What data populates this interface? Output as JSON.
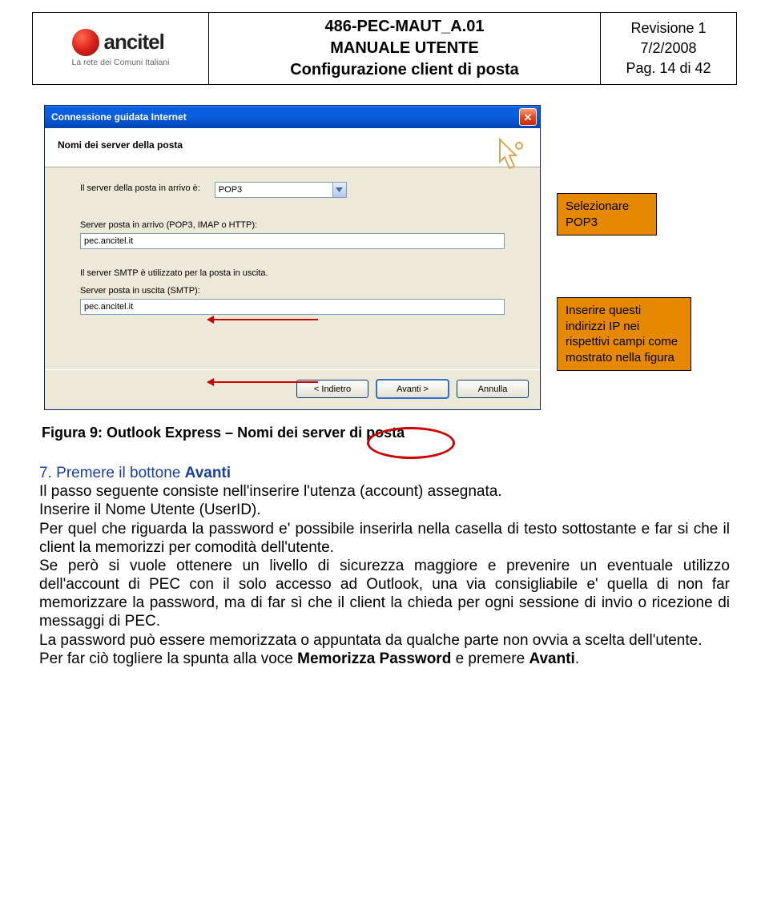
{
  "header": {
    "logo_text": "ancitel",
    "logo_sub": "La rete dei Comuni Italiani",
    "title_line1": "486-PEC-MAUT_A.01",
    "title_line2": "MANUALE UTENTE",
    "title_line3": "Configurazione client di posta",
    "rev_line1": "Revisione 1",
    "rev_line2": "7/2/2008",
    "rev_line3": "Pag. 14 di 42"
  },
  "dialog": {
    "title": "Connessione guidata Internet",
    "header_title": "Nomi dei server della posta",
    "incoming_label": "Il server della posta in arrivo è:",
    "incoming_select_value": "POP3",
    "incoming_server_label": "Server posta in arrivo (POP3, IMAP o HTTP):",
    "incoming_server_value": "pec.ancitel.it",
    "smtp_note": "Il server SMTP è utilizzato per la posta in uscita.",
    "outgoing_server_label": "Server posta in uscita (SMTP):",
    "outgoing_server_value": "pec.ancitel.it",
    "btn_back": "< Indietro",
    "btn_next": "Avanti >",
    "btn_cancel": "Annulla"
  },
  "callouts": {
    "pop3": "Selezionare POP3",
    "ip": "Inserire questi indirizzi IP nei rispettivi campi come mostrato nella figura"
  },
  "caption": "Figura 9: Outlook Express – Nomi dei server di posta",
  "steps": {
    "num": "7.",
    "text_prefix": "Premere il bottone ",
    "text_bold": "Avanti"
  },
  "paragraphs": {
    "p1": "Il passo seguente consiste nell'inserire l'utenza (account) assegnata.",
    "p2": "Inserire il Nome Utente (UserID).",
    "p3": "Per quel che riguarda la password e' possibile inserirla nella casella di testo sottostante e far si che il client la memorizzi per comodità dell'utente.",
    "p4": "Se però si vuole ottenere un livello di sicurezza maggiore e prevenire un eventuale utilizzo dell'account di PEC con il solo accesso ad Outlook, una via consigliabile e' quella di non far memorizzare la password, ma di far sì che il client la chieda per ogni sessione di invio o ricezione di messaggi di PEC.",
    "p5": "La password può essere memorizzata o appuntata da qualche parte non ovvia a scelta dell'utente.",
    "p6_prefix": "Per far ciò togliere la spunta alla voce ",
    "p6_bold1": "Memorizza Password",
    "p6_mid": " e premere ",
    "p6_bold2": "Avanti",
    "p6_suffix": "."
  }
}
